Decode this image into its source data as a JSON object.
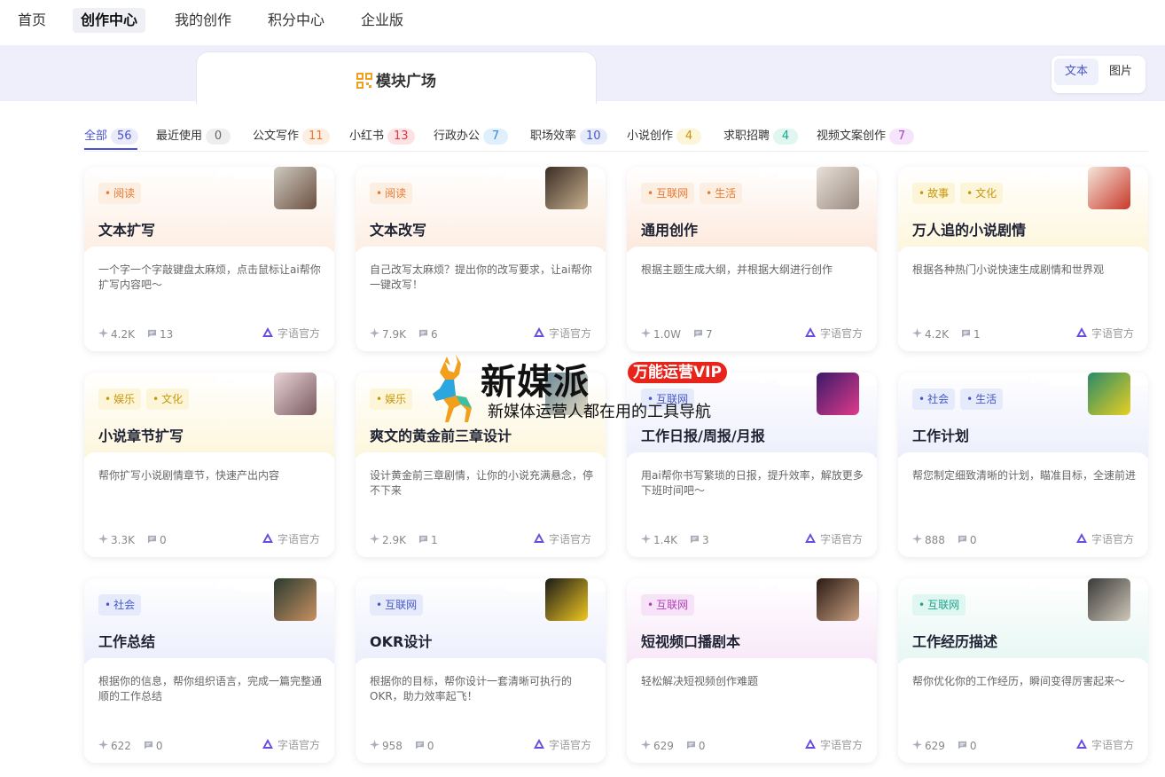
{
  "nav": [
    {
      "label": "首页",
      "active": false
    },
    {
      "label": "创作中心",
      "active": true
    },
    {
      "label": "我的创作",
      "active": false
    },
    {
      "label": "积分中心",
      "active": false
    },
    {
      "label": "企业版",
      "active": false
    }
  ],
  "plaza": {
    "title": "模块广场"
  },
  "toggle": {
    "text": "文本",
    "image": "图片"
  },
  "categories": [
    {
      "label": "全部",
      "count": "56"
    },
    {
      "label": "最近使用",
      "count": "0"
    },
    {
      "label": "公文写作",
      "count": "11"
    },
    {
      "label": "小红书",
      "count": "13"
    },
    {
      "label": "行政办公",
      "count": "7"
    },
    {
      "label": "职场效率",
      "count": "10"
    },
    {
      "label": "小说创作",
      "count": "4"
    },
    {
      "label": "求职招聘",
      "count": "4"
    },
    {
      "label": "视频文案创作",
      "count": "7"
    }
  ],
  "cards": [
    {
      "tags": [
        "阅读"
      ],
      "title": "文本扩写",
      "desc": "一个字一个字敲键盘太麻烦，点击鼠标让ai帮你扩写内容吧～",
      "likes": "4.2K",
      "comments": "13",
      "author": "字语官方"
    },
    {
      "tags": [
        "阅读"
      ],
      "title": "文本改写",
      "desc": "自己改写太麻烦？提出你的改写要求，让ai帮你一键改写！",
      "likes": "7.9K",
      "comments": "6",
      "author": "字语官方"
    },
    {
      "tags": [
        "互联网",
        "生活"
      ],
      "title": "通用创作",
      "desc": "根据主题生成大纲，并根据大纲进行创作",
      "likes": "1.0W",
      "comments": "7",
      "author": "字语官方"
    },
    {
      "tags": [
        "故事",
        "文化"
      ],
      "title": "万人追的小说剧情",
      "desc": "根据各种热门小说快速生成剧情和世界观",
      "likes": "4.2K",
      "comments": "1",
      "author": "字语官方"
    },
    {
      "tags": [
        "娱乐",
        "文化"
      ],
      "title": "小说章节扩写",
      "desc": "帮你扩写小说剧情章节，快速产出内容",
      "likes": "3.3K",
      "comments": "0",
      "author": "字语官方"
    },
    {
      "tags": [
        "娱乐"
      ],
      "title": "爽文的黄金前三章设计",
      "desc": "设计黄金前三章剧情，让你的小说充满悬念，停不下来",
      "likes": "2.9K",
      "comments": "1",
      "author": "字语官方"
    },
    {
      "tags": [
        "互联网"
      ],
      "title": "工作日报/周报/月报",
      "desc": "用ai帮你书写繁琐的日报，提升效率，解放更多下班时间吧～",
      "likes": "1.4K",
      "comments": "3",
      "author": "字语官方"
    },
    {
      "tags": [
        "社会",
        "生活"
      ],
      "title": "工作计划",
      "desc": "帮您制定细致清晰的计划，瞄准目标，全速前进",
      "likes": "888",
      "comments": "0",
      "author": "字语官方"
    },
    {
      "tags": [
        "社会"
      ],
      "title": "工作总结",
      "desc": "根据你的信息，帮你组织语言，完成一篇完整通顺的工作总结",
      "likes": "622",
      "comments": "0",
      "author": "字语官方"
    },
    {
      "tags": [
        "互联网"
      ],
      "title": "OKR设计",
      "desc": "根据你的目标，帮你设计一套清晰可执行的OKR，助力效率起飞！",
      "likes": "958",
      "comments": "0",
      "author": "字语官方"
    },
    {
      "tags": [
        "互联网"
      ],
      "title": "短视频口播剧本",
      "desc": "轻松解决短视频创作难题",
      "likes": "629",
      "comments": "0",
      "author": "字语官方"
    },
    {
      "tags": [
        "互联网"
      ],
      "title": "工作经历描述",
      "desc": "帮你优化你的工作经历，瞬间变得厉害起来～",
      "likes": "629",
      "comments": "0",
      "author": "字语官方"
    }
  ],
  "watermark": {
    "name": "新媒派",
    "badge": "万能运营VIP",
    "sub": "新媒体运营人都在用的工具导航"
  }
}
